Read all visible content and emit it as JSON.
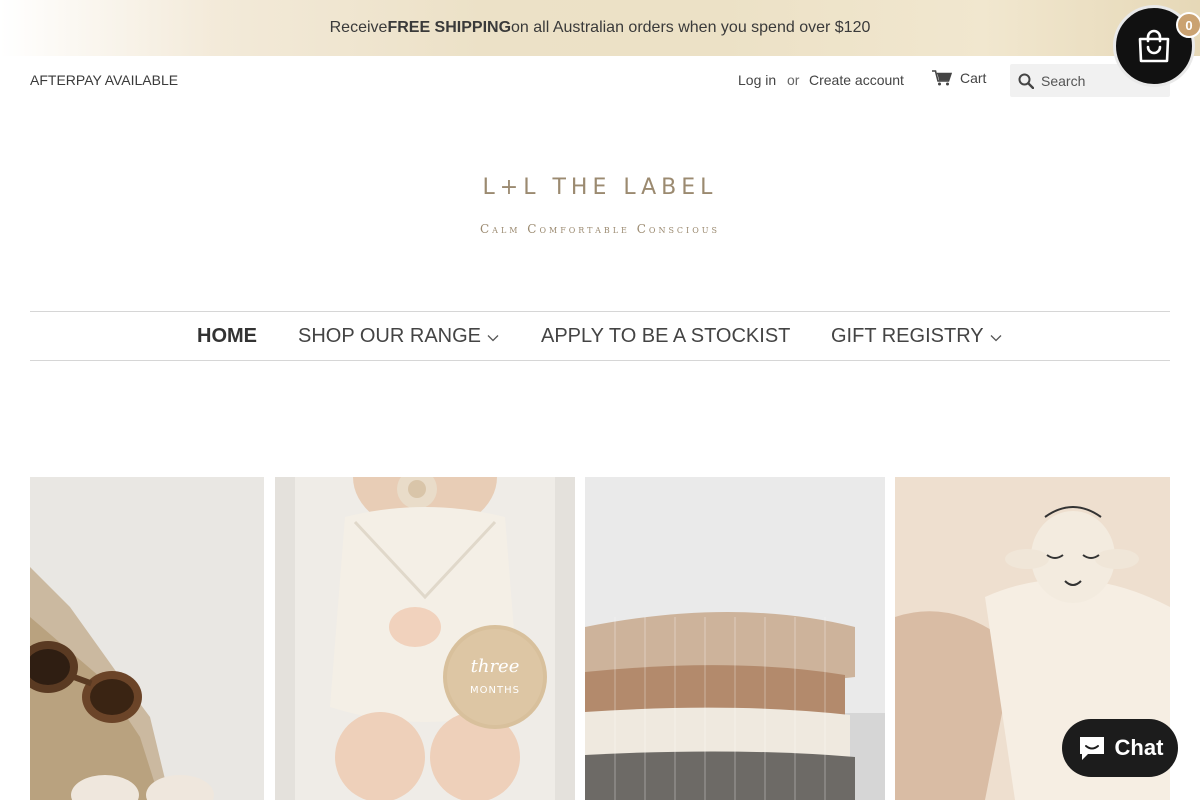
{
  "announcement": {
    "prefix": "Receive ",
    "bold": "FREE SHIPPING",
    "suffix": " on all Australian orders when you spend over $120"
  },
  "utility": {
    "afterpay": "AFTERPAY AVAILABLE",
    "login": "Log in",
    "or": "or",
    "create_account": "Create account",
    "cart": "Cart",
    "search_placeholder": "Search"
  },
  "bag": {
    "count": "0"
  },
  "logo": {
    "title": "L+L THE LABEL",
    "tagline": "Calm Comfortable Conscious"
  },
  "nav": {
    "items": [
      {
        "label": "HOME",
        "active": true
      },
      {
        "label": "SHOP OUR RANGE",
        "has_dropdown": true
      },
      {
        "label": "APPLY TO BE A STOCKIST"
      },
      {
        "label": "GIFT REGISTRY",
        "has_dropdown": true
      }
    ]
  },
  "chat": {
    "label": "Chat"
  },
  "colors": {
    "logo": "#9b8a70",
    "badge": "#caa271",
    "dark": "#1c1c1c"
  }
}
